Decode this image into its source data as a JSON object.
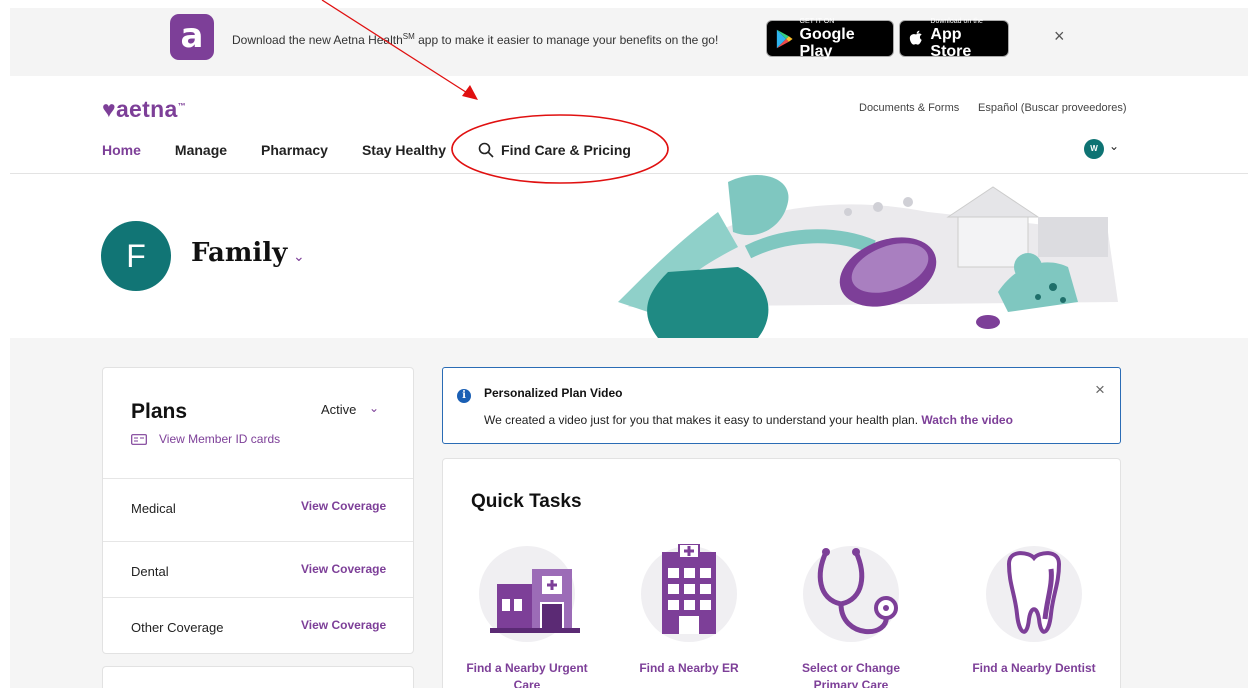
{
  "banner": {
    "logo_letter": "a",
    "text_before": "Download the new Aetna Health",
    "text_sup": "SM",
    "text_after": " app to make it easier to manage your benefits on the go!",
    "google_play_small": "GET IT ON",
    "google_play_big": "Google Play",
    "app_store_small": "Download on the",
    "app_store_big": "App Store",
    "close": "×"
  },
  "header": {
    "logo": "aetna",
    "logo_tm": "™",
    "util_links": [
      "Documents & Forms",
      "Español (Buscar proveedores)"
    ],
    "nav": [
      "Home",
      "Manage",
      "Pharmacy",
      "Stay Healthy",
      "Find Care & Pricing"
    ],
    "user_initial": "W"
  },
  "hero": {
    "avatar_initial": "F",
    "title": "Family"
  },
  "plans": {
    "title": "Plans",
    "status": "Active",
    "id_link": "View Member ID cards",
    "rows": [
      {
        "name": "Medical",
        "link": "View Coverage"
      },
      {
        "name": "Dental",
        "link": "View Coverage"
      },
      {
        "name": "Other Coverage",
        "link": "View Coverage"
      }
    ]
  },
  "notice": {
    "title": "Personalized Plan Video",
    "body": "We created a video just for you that makes it easy to understand your health plan.",
    "link": "Watch the video"
  },
  "quick_tasks": {
    "title": "Quick Tasks",
    "items": [
      {
        "label": "Find a Nearby Urgent Care",
        "icon": "urgent-care-building-icon"
      },
      {
        "label": "Find a Nearby ER",
        "icon": "hospital-icon"
      },
      {
        "label": "Select or Change Primary Care Physician",
        "icon": "stethoscope-icon"
      },
      {
        "label": "Find a Nearby Dentist",
        "icon": "tooth-icon"
      }
    ]
  },
  "colors": {
    "brand_purple": "#7d3f98",
    "teal": "#117575",
    "info_blue": "#2a6cb5",
    "annotation_red": "#e01010"
  }
}
